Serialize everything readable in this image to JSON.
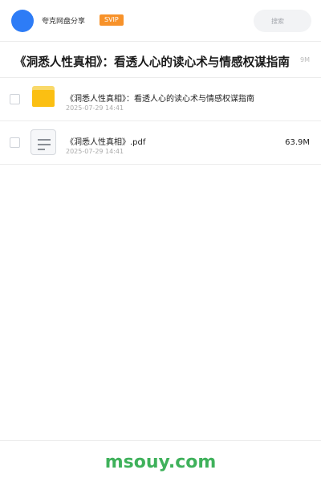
{
  "header": {
    "username": "夸克网盘分享",
    "badge": "SVIP",
    "search_placeholder": "搜索"
  },
  "title_bar": {
    "title": "《洞悉人性真相》：看透人心的读心术与情感权谋指南",
    "size_fragment": "9M"
  },
  "files": [
    {
      "icon": "folder-icon",
      "name": "《洞悉人性真相》：看透人心的读心术与情感权谋指南",
      "date": "2025-07-29 14:41",
      "size": ""
    },
    {
      "icon": "document-icon",
      "name": "《洞悉人性真相》.pdf",
      "date": "2025-07-29 14:41",
      "size": "63.9M"
    }
  ],
  "footer": {
    "watermark": "msouy.com"
  },
  "colors": {
    "avatar": "#2d7cf6",
    "badge": "#f7922a",
    "folder": "#fbbf12",
    "watermark": "#3fb15b"
  }
}
